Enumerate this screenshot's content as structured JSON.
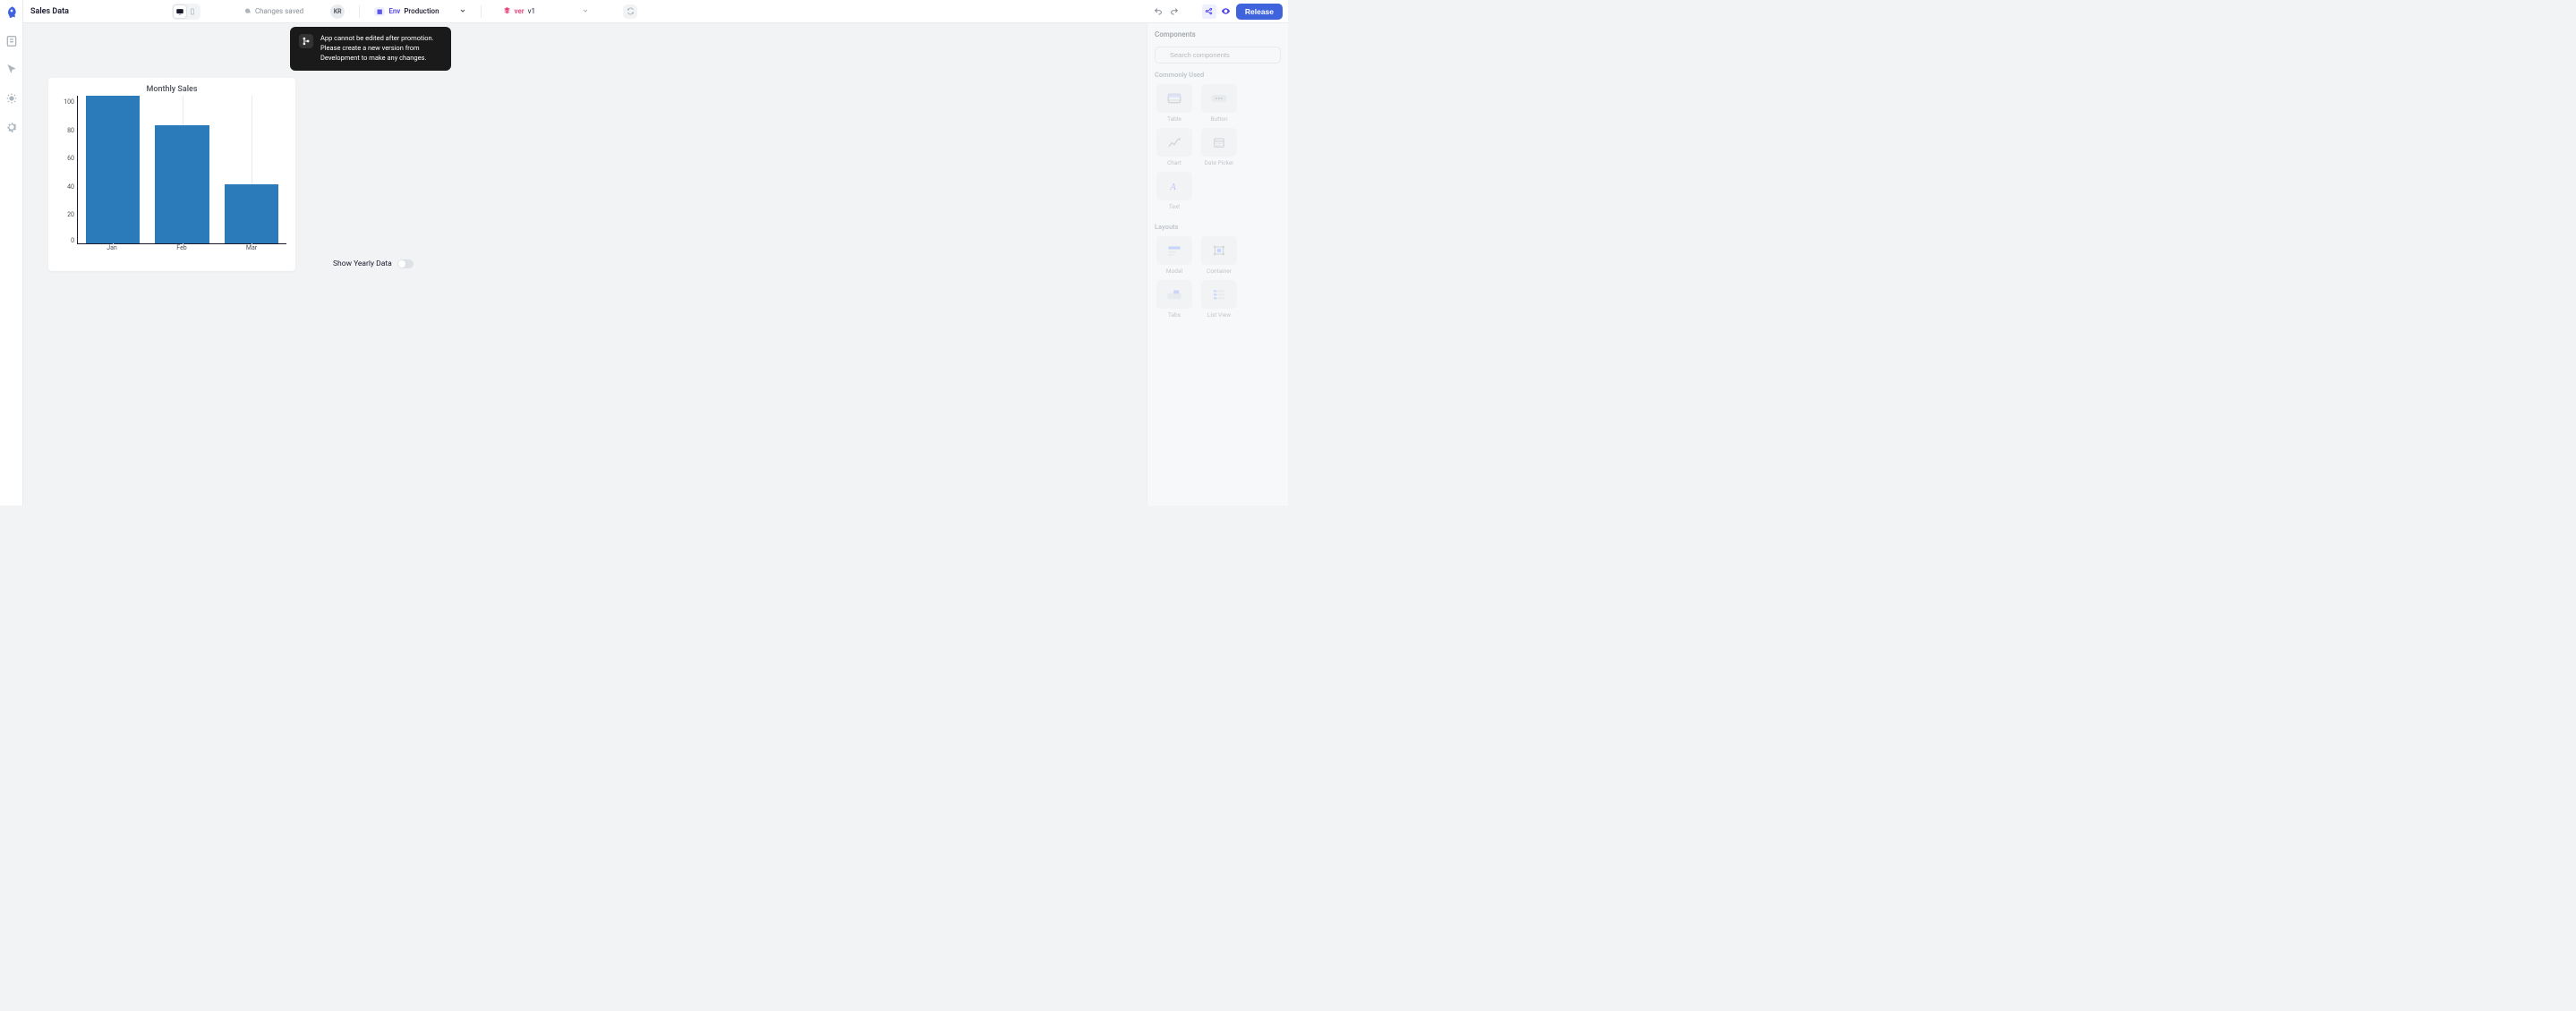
{
  "app_title": "Sales Data",
  "header": {
    "save_status": "Changes saved",
    "avatar_initials": "KR",
    "env": {
      "badge": "Env",
      "value": "Production"
    },
    "ver": {
      "label": "ver",
      "value": "v1"
    },
    "release_label": "Release"
  },
  "toast": {
    "message": "App cannot be edited after promotion. Please create a new version from Development to make any changes."
  },
  "toggle": {
    "label": "Show Yearly Data"
  },
  "right_panel": {
    "title": "Components",
    "search_placeholder": "Search components",
    "section_common": "Commonly Used",
    "section_layouts": "Layouts",
    "common_tiles": [
      "Table",
      "Button",
      "Chart",
      "Date Picker",
      "Text"
    ],
    "layout_tiles": [
      "Modal",
      "Container",
      "Tabs",
      "List View"
    ]
  },
  "chart_data": {
    "type": "bar",
    "title": "Monthly Sales",
    "categories": [
      "Jan",
      "Feb",
      "Mar"
    ],
    "values": [
      100,
      80,
      40
    ],
    "ylim": [
      0,
      100
    ],
    "yticks": [
      0,
      20,
      40,
      60,
      80,
      100
    ],
    "xlabel": "",
    "ylabel": ""
  }
}
